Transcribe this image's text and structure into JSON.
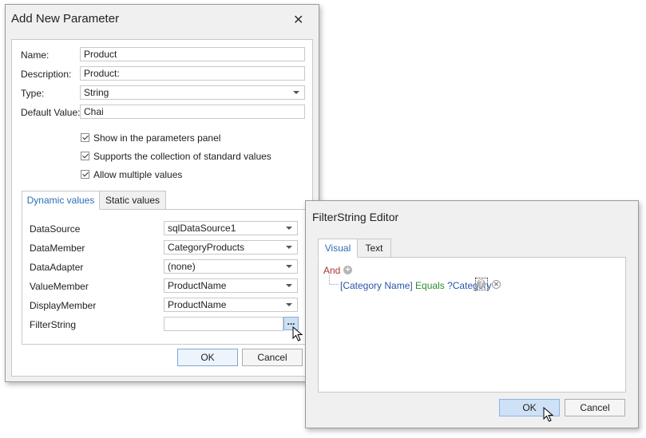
{
  "add_param": {
    "title": "Add New Parameter",
    "close_glyph": "✕",
    "fields": {
      "name": {
        "label": "Name:",
        "value": "Product"
      },
      "description": {
        "label": "Description:",
        "value": "Product:"
      },
      "type": {
        "label": "Type:",
        "value": "String"
      },
      "default_value": {
        "label": "Default Value:",
        "value": "Chai"
      }
    },
    "checkboxes": [
      {
        "label": "Show in the parameters panel",
        "checked": true
      },
      {
        "label": "Supports the collection of standard values",
        "checked": true
      },
      {
        "label": "Allow multiple values",
        "checked": true
      }
    ],
    "tabs": [
      {
        "label": "Dynamic values",
        "active": true
      },
      {
        "label": "Static values",
        "active": false
      }
    ],
    "dynamic": {
      "data_source": {
        "label": "DataSource",
        "value": "sqlDataSource1"
      },
      "data_member": {
        "label": "DataMember",
        "value": "CategoryProducts"
      },
      "data_adapter": {
        "label": "DataAdapter",
        "value": "(none)"
      },
      "value_member": {
        "label": "ValueMember",
        "value": "ProductName"
      },
      "display_member": {
        "label": "DisplayMember",
        "value": "ProductName"
      },
      "filter_string": {
        "label": "FilterString",
        "value": "",
        "button": "..."
      }
    },
    "ok": "OK",
    "cancel": "Cancel"
  },
  "filter_editor": {
    "title": "FilterString Editor",
    "tabs": [
      {
        "label": "Visual",
        "active": true
      },
      {
        "label": "Text",
        "active": false
      }
    ],
    "group_operator": "And",
    "condition": {
      "property": "[Category Name]",
      "operator": "Equals",
      "value": "?Category"
    },
    "icons": {
      "add": "plus-circle-icon",
      "param": "question-circle-icon",
      "remove": "x-circle-icon"
    },
    "ok": "OK",
    "cancel": "Cancel"
  }
}
